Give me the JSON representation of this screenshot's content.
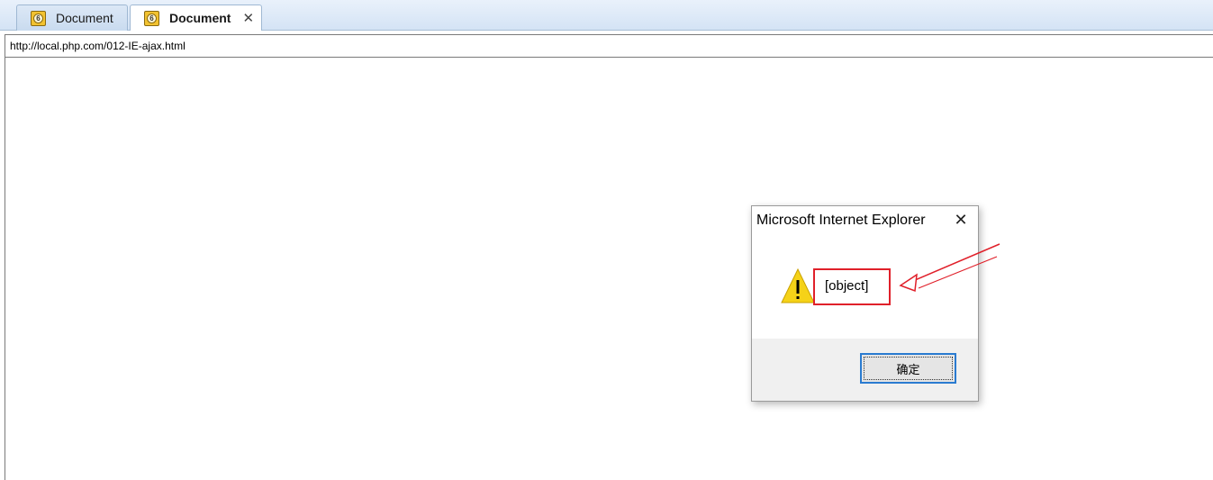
{
  "tabs": [
    {
      "label": "Document",
      "icon": "ie6-page-icon",
      "active": false
    },
    {
      "label": "Document",
      "icon": "ie6-page-icon",
      "active": true,
      "close": "✕"
    }
  ],
  "tab_icon_glyph": "6",
  "address_bar": {
    "url": "http://local.php.com/012-IE-ajax.html"
  },
  "alert_dialog": {
    "title": "Microsoft Internet Explorer",
    "close_glyph": "✕",
    "icon": "warning-icon",
    "message": "[object]",
    "ok_label": "确定"
  },
  "colors": {
    "highlight_box": "#e0202a",
    "annotation_arrow": "#e0202a",
    "ok_focus": "#2a7bd0",
    "tab_bar": "#d4e3f5"
  }
}
